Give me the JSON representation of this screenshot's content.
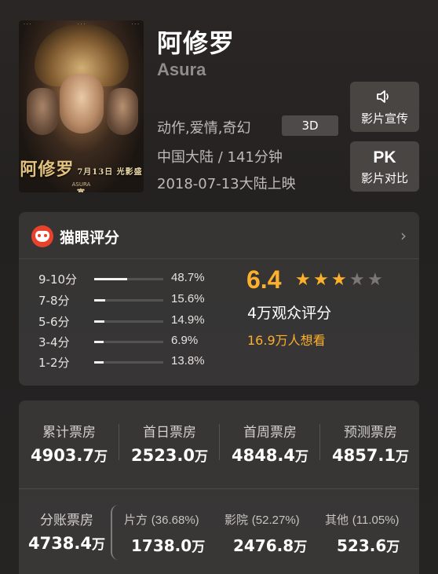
{
  "movie": {
    "title": "阿修罗",
    "subtitle": "Asura",
    "genres": "动作,爱情,奇幻",
    "format_badge": "3D",
    "origin": "中国大陆 / 141分钟",
    "release": "2018-07-13大陆上映",
    "poster": {
      "title_art": "ASURA",
      "title_cn": "阿修罗",
      "date_art": "7月13日 光影盛宴"
    }
  },
  "actions": {
    "promo": {
      "icon": "speaker-icon",
      "label": "影片宣传"
    },
    "pk": {
      "icon_text": "PK",
      "label": "影片对比"
    }
  },
  "rating": {
    "title": "猫眼评分",
    "score": "6.4",
    "stars": 3.2,
    "stars_max": 5,
    "voters": "4万观众评分",
    "wish": "16.9万人想看",
    "distribution": [
      {
        "label": "9-10分",
        "pct": "48.7%",
        "value": 48.7
      },
      {
        "label": "7-8分",
        "pct": "15.6%",
        "value": 15.6
      },
      {
        "label": "5-6分",
        "pct": "14.9%",
        "value": 14.9
      },
      {
        "label": "3-4分",
        "pct": "6.9%",
        "value": 6.9
      },
      {
        "label": "1-2分",
        "pct": "13.8%",
        "value": 13.8
      }
    ]
  },
  "box_office": {
    "stats": [
      {
        "label": "累计票房",
        "value": "4903.7",
        "unit": "万"
      },
      {
        "label": "首日票房",
        "value": "2523.0",
        "unit": "万"
      },
      {
        "label": "首周票房",
        "value": "4848.4",
        "unit": "万"
      },
      {
        "label": "预测票房",
        "value": "4857.1",
        "unit": "万"
      }
    ],
    "split": {
      "label": "分账票房",
      "value": "4738.4",
      "unit": "万",
      "parts": [
        {
          "label": "片方",
          "pct": "(36.68%)",
          "value": "1738.0",
          "unit": "万"
        },
        {
          "label": "影院",
          "pct": "(52.27%)",
          "value": "2476.8",
          "unit": "万"
        },
        {
          "label": "其他",
          "pct": "(11.05%)",
          "value": "523.6",
          "unit": "万"
        }
      ]
    }
  }
}
